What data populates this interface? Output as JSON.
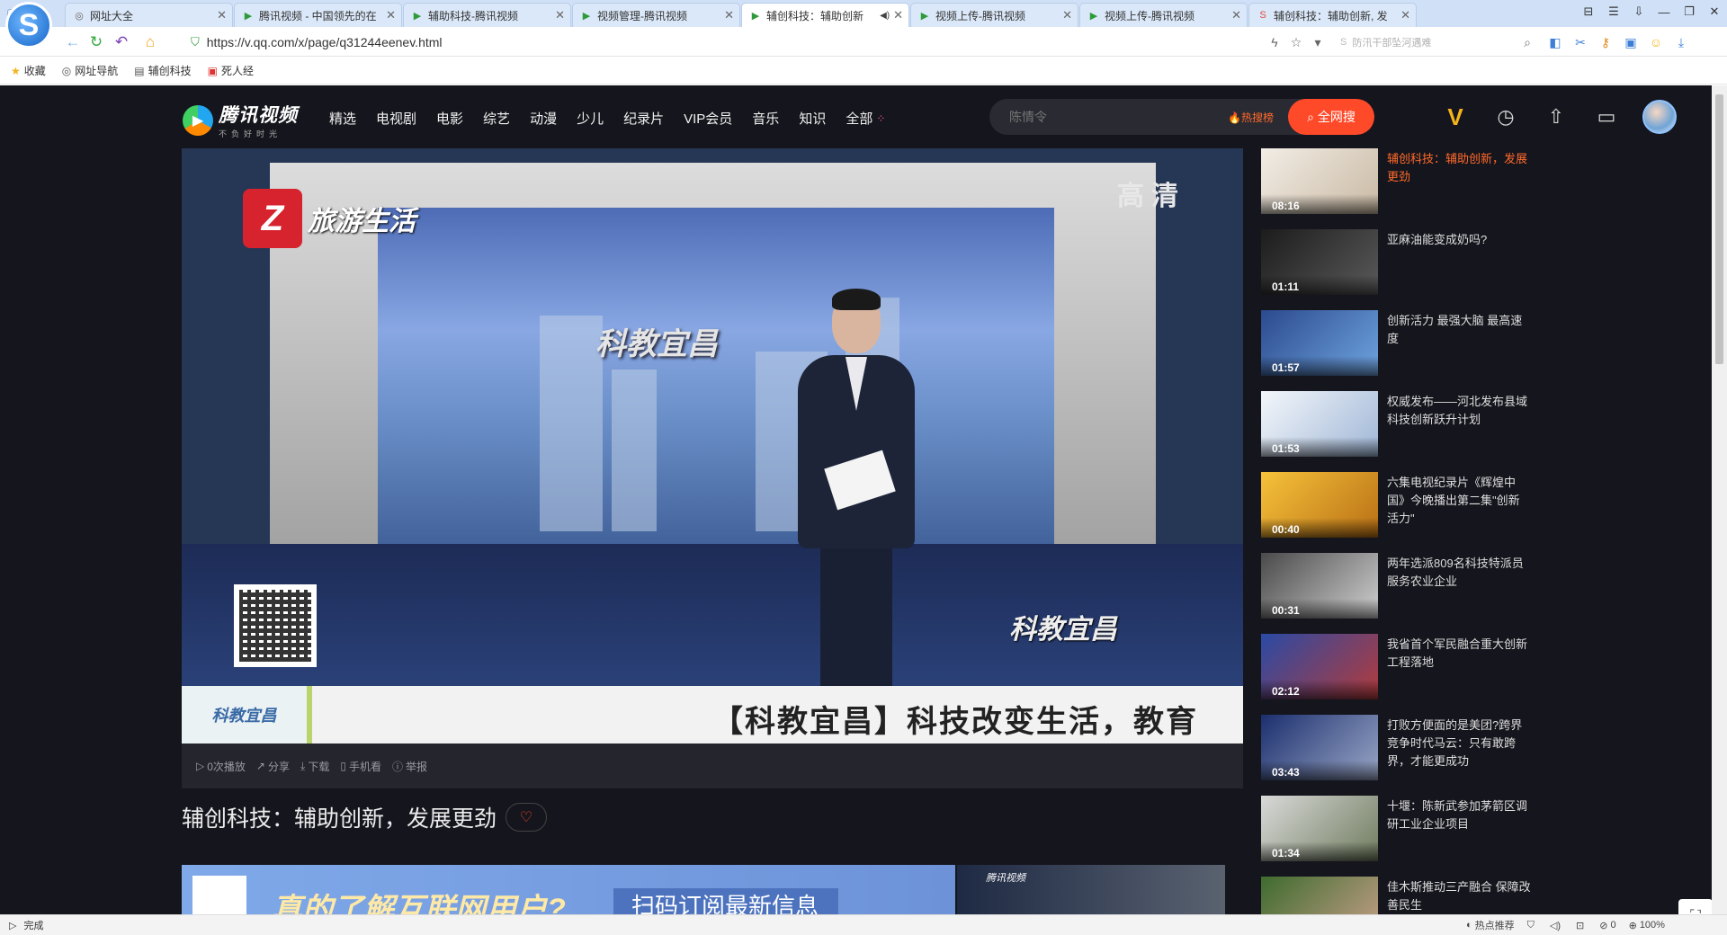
{
  "browser": {
    "logo_glyph": "S",
    "tabs": [
      {
        "label": "网址大全",
        "favicon": "globe-icon",
        "glyph": "◎"
      },
      {
        "label": "腾讯视频 - 中国领先的在",
        "favicon": "tencent-video-icon",
        "glyph": "▶"
      },
      {
        "label": "辅助科技-腾讯视频",
        "favicon": "tencent-video-icon",
        "glyph": "▶"
      },
      {
        "label": "视频管理-腾讯视频",
        "favicon": "tencent-video-icon",
        "glyph": "▶"
      },
      {
        "label": "辅创科技：辅助创新",
        "favicon": "tencent-video-icon",
        "glyph": "▶",
        "active": true
      },
      {
        "label": "视频上传-腾讯视频",
        "favicon": "tencent-video-icon",
        "glyph": "▶"
      },
      {
        "label": "视频上传-腾讯视频",
        "favicon": "tencent-video-icon",
        "glyph": "▶"
      },
      {
        "label": "辅创科技：辅助创新, 发",
        "favicon": "sogou-icon",
        "glyph": "S"
      }
    ],
    "close_glyph": "✕",
    "audio_glyph": "◀)",
    "window_controls": [
      "⊟",
      "☰",
      "⇩",
      "—",
      "❐",
      "✕"
    ],
    "url": "https://v.qq.com/x/page/q31244eenev.html",
    "secure_glyph": "⛉",
    "side_search_placeholder": "防汛干部坠河遇难",
    "bookmarks": [
      {
        "label": "收藏",
        "glyph": "★"
      },
      {
        "label": "网址导航",
        "glyph": "◎"
      },
      {
        "label": "辅创科技",
        "glyph": "▤"
      },
      {
        "label": "死人经",
        "glyph": "▣"
      }
    ],
    "status_text": "完成",
    "status_right": [
      {
        "label": "热点推荐",
        "glyph": "◐"
      },
      {
        "label": "",
        "glyph": "⛉"
      },
      {
        "label": "",
        "glyph": "◁)"
      },
      {
        "label": "",
        "glyph": "⊡"
      },
      {
        "label": "0",
        "glyph": "⊘"
      },
      {
        "label": "100%",
        "glyph": "⊕"
      }
    ]
  },
  "site": {
    "logo_main": "腾讯视频",
    "logo_sub": "不负好时光",
    "nav": [
      "精选",
      "电视剧",
      "电影",
      "综艺",
      "动漫",
      "少儿",
      "纪录片",
      "VIP会员",
      "音乐",
      "知识",
      "全部"
    ],
    "search_placeholder": "陈情令",
    "hot_search": "🔥热搜榜",
    "search_button": "全网搜",
    "accent_color": "#ff4a2a"
  },
  "video": {
    "channel_name": "旅游生活",
    "hd_mark": "高清",
    "screen_title": "科教宜昌",
    "bug_logo": "科教宜昌",
    "lower_third_logo": "科教宜昌",
    "ticker": "【科教宜昌】科技改变生活，教育",
    "actions": [
      {
        "label": "0次播放",
        "icon": "play-count-icon",
        "glyph": "▷"
      },
      {
        "label": "分享",
        "icon": "share-icon",
        "glyph": "↗"
      },
      {
        "label": "下载",
        "icon": "download-icon",
        "glyph": "⤓"
      },
      {
        "label": "手机看",
        "icon": "phone-icon",
        "glyph": "▯"
      },
      {
        "label": "举报",
        "icon": "report-icon",
        "glyph": "ⓘ"
      }
    ],
    "title": "辅创科技：辅助创新，发展更劲"
  },
  "banners": {
    "left_text1": "真的了解互联网用户?",
    "left_text2": "扫码订阅最新信息",
    "right_logo": "腾讯视频"
  },
  "playlist": [
    {
      "title": "辅创科技：辅助创新，发展更劲",
      "duration": "08:16",
      "current": true,
      "thumb_bg": "linear-gradient(135deg,#f2ede6,#c9b9a3)"
    },
    {
      "title": "亚麻油能变成奶吗?",
      "duration": "01:11",
      "current": false,
      "thumb_bg": "linear-gradient(135deg,#1c1c1c,#5a5a5a)"
    },
    {
      "title": "创新活力 最强大脑 最高速度",
      "duration": "01:57",
      "current": false,
      "thumb_bg": "linear-gradient(135deg,#2b4a8d,#6fa4e0)"
    },
    {
      "title": "权威发布——河北发布县域科技创新跃升计划",
      "duration": "01:53",
      "current": false,
      "thumb_bg": "linear-gradient(135deg,#f4f7fb,#9fb6d6)"
    },
    {
      "title": "六集电视纪录片《辉煌中国》今晚播出第二集\"创新活力\"",
      "duration": "00:40",
      "current": false,
      "thumb_bg": "linear-gradient(135deg,#f6c23a,#b86f15)"
    },
    {
      "title": "两年选派809名科技特派员服务农业企业",
      "duration": "00:31",
      "current": false,
      "thumb_bg": "linear-gradient(135deg,#4a4a4a,#d0d0d0)"
    },
    {
      "title": "我省首个军民融合重大创新工程落地",
      "duration": "02:12",
      "current": false,
      "thumb_bg": "linear-gradient(135deg,#2a4aa5,#b33b3b)"
    },
    {
      "title": "打败方便面的是美团?跨界竞争时代马云：只有敢跨界，才能更成功",
      "duration": "03:43",
      "current": false,
      "thumb_bg": "linear-gradient(135deg,#1c2f6e,#9aa7c7)"
    },
    {
      "title": "十堰：陈新武参加茅箭区调研工业企业项目",
      "duration": "01:34",
      "current": false,
      "thumb_bg": "linear-gradient(135deg,#d9d9d9,#6f7c5e)"
    },
    {
      "title": "佳木斯推动三产融合 保障改善民生",
      "duration": "",
      "current": false,
      "thumb_bg": "linear-gradient(135deg,#3e6b2e,#c8a08a)"
    }
  ]
}
